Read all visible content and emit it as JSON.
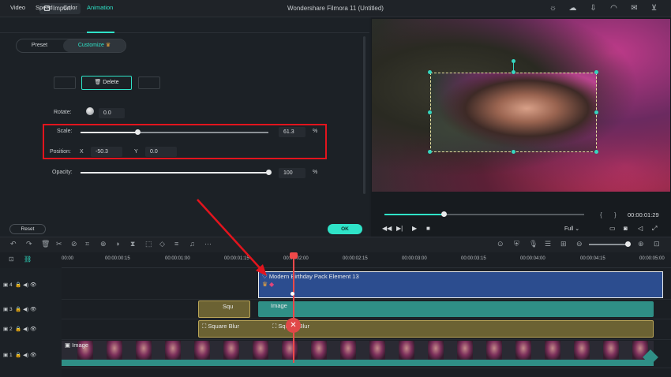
{
  "app": {
    "title": "Wondershare Filmora 11 (Untitled)",
    "import_label": "Import"
  },
  "tabs": [
    "Video",
    "Speed",
    "Color",
    "Animation"
  ],
  "segment": {
    "preset": "Preset",
    "customize": "Customize"
  },
  "keyframe": {
    "delete_label": "Delete"
  },
  "rotate": {
    "label": "Rotate:",
    "value": "0.0"
  },
  "scale": {
    "label": "Scale:",
    "value": "61.3",
    "unit": "%",
    "level": 0.613
  },
  "position": {
    "label": "Position:",
    "x_label": "X",
    "x_value": "-50.3",
    "y_label": "Y",
    "y_value": "0.0"
  },
  "opacity": {
    "label": "Opacity:",
    "value": "100",
    "unit": "%",
    "level": 1.0
  },
  "buttons": {
    "reset": "Reset",
    "ok": "OK"
  },
  "preview": {
    "time": "00:00:01:29",
    "quality": "Full",
    "progress": 0.3
  },
  "ruler": [
    "00:00",
    "00:00:00:15",
    "00:00:01:00",
    "00:00:01:15",
    "00:00:02:00",
    "00:00:02:15",
    "00:00:03:00",
    "00:00:03:15",
    "00:00:04:00",
    "00:00:04:15",
    "00:00:05:00"
  ],
  "tracks": [
    "4",
    "3",
    "2",
    "1"
  ],
  "clips": {
    "element": "Modern Birthday Pack Element 13",
    "image_top": "Image",
    "blur_small": "Squ",
    "square_blur_1": "Square Blur",
    "square_blur_2": "Square Blur",
    "image_bottom": "Image"
  }
}
